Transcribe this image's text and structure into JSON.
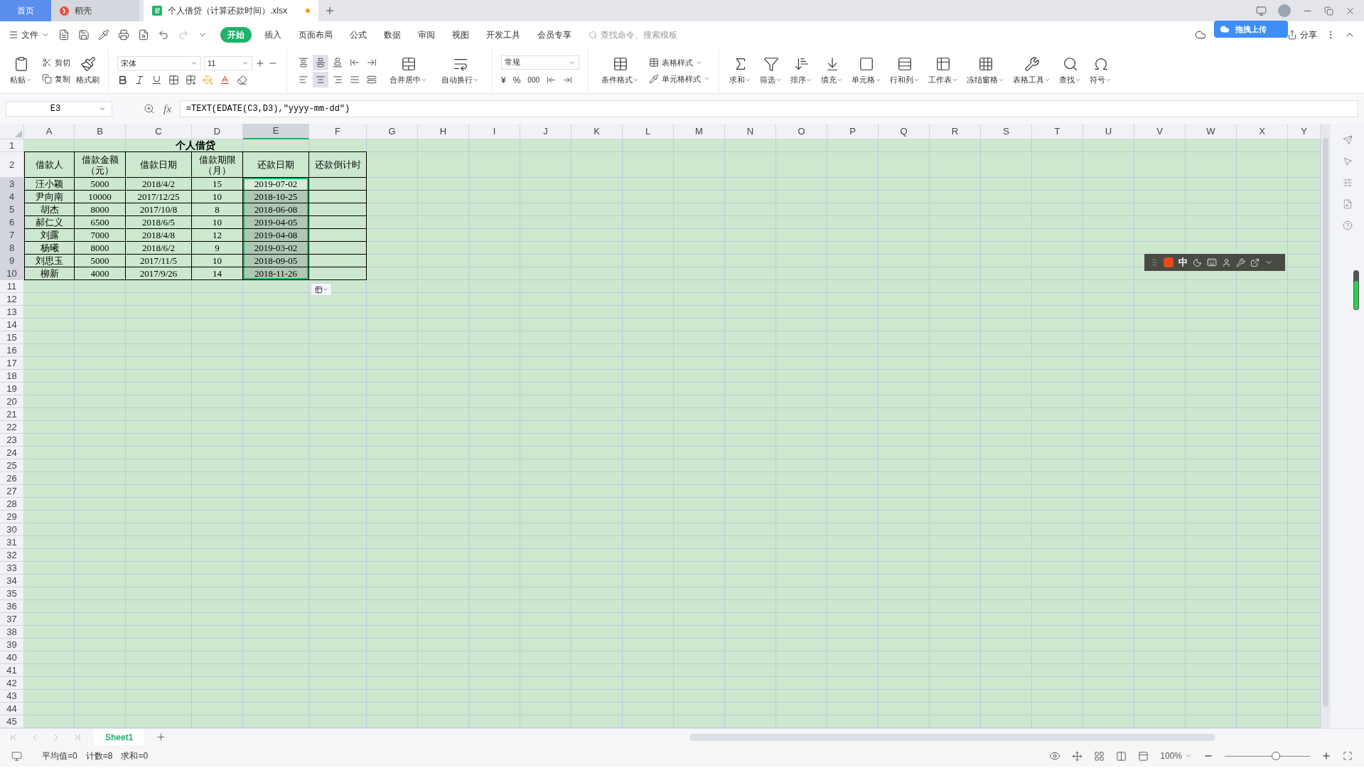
{
  "tabs": [
    {
      "label": "首页",
      "kind": "home",
      "selected": false,
      "modified": false
    },
    {
      "label": "稻壳",
      "kind": "docer",
      "selected": false,
      "modified": false
    },
    {
      "label": "个人借贷（计算还款时间）.xlsx",
      "kind": "file",
      "selected": true,
      "modified": true
    }
  ],
  "menu": {
    "file": "文件",
    "items": [
      {
        "label": "开始",
        "selected": true
      },
      {
        "label": "插入",
        "selected": false
      },
      {
        "label": "页面布局",
        "selected": false
      },
      {
        "label": "公式",
        "selected": false
      },
      {
        "label": "数据",
        "selected": false
      },
      {
        "label": "审阅",
        "selected": false
      },
      {
        "label": "视图",
        "selected": false
      },
      {
        "label": "开发工具",
        "selected": false
      },
      {
        "label": "会员专享",
        "selected": false
      }
    ],
    "search_placeholder": "查找命令、搜索模板",
    "share": "分享",
    "upload_popup": "拖拽上传"
  },
  "clipboard": {
    "paste": "粘贴",
    "cut": "剪切",
    "copy": "复制",
    "format_painter": "格式刷"
  },
  "font": {
    "name": "宋体",
    "size": "11"
  },
  "align_buttons": [
    {
      "kind": "top",
      "selected": false
    },
    {
      "kind": "middle",
      "selected": true
    },
    {
      "kind": "bottom",
      "selected": false
    },
    {
      "kind": "outdent",
      "selected": false
    },
    {
      "kind": "indent",
      "selected": false
    },
    {
      "kind": "left",
      "selected": false
    },
    {
      "kind": "center",
      "selected": true
    },
    {
      "kind": "right",
      "selected": false
    },
    {
      "kind": "justify",
      "selected": false
    },
    {
      "kind": "distributed",
      "selected": false
    }
  ],
  "merge": {
    "merge": "合并居中",
    "wrap": "自动换行"
  },
  "number": {
    "format": "常规",
    "currency": "¥",
    "percent": "%",
    "thousands": "000"
  },
  "styles": {
    "conditional": "条件格式",
    "table_style": "表格样式",
    "cell_style": "单元格样式"
  },
  "tools": [
    {
      "label": "求和",
      "kind": "sum"
    },
    {
      "label": "筛选",
      "kind": "filter"
    },
    {
      "label": "排序",
      "kind": "sort"
    },
    {
      "label": "填充",
      "kind": "fill"
    },
    {
      "label": "单元格",
      "kind": "cell"
    },
    {
      "label": "行和列",
      "kind": "rowcol"
    },
    {
      "label": "工作表",
      "kind": "sheet"
    },
    {
      "label": "冻结窗格",
      "kind": "freeze"
    },
    {
      "label": "表格工具",
      "kind": "tabletools"
    },
    {
      "label": "查找",
      "kind": "find"
    },
    {
      "label": "符号",
      "kind": "symbol"
    }
  ],
  "name_box": "E3",
  "function_label": "fx",
  "formula": "=TEXT(EDATE(C3,D3),\"yyyy-mm-dd\")",
  "columns": [
    {
      "label": "A",
      "selected": false
    },
    {
      "label": "B",
      "selected": false
    },
    {
      "label": "C",
      "selected": false
    },
    {
      "label": "D",
      "selected": false
    },
    {
      "label": "E",
      "selected": true
    },
    {
      "label": "F",
      "selected": false
    },
    {
      "label": "G",
      "selected": false
    },
    {
      "label": "H",
      "selected": false
    },
    {
      "label": "I",
      "selected": false
    },
    {
      "label": "J",
      "selected": false
    },
    {
      "label": "K",
      "selected": false
    },
    {
      "label": "L",
      "selected": false
    },
    {
      "label": "M",
      "selected": false
    },
    {
      "label": "N",
      "selected": false
    },
    {
      "label": "O",
      "selected": false
    },
    {
      "label": "P",
      "selected": false
    },
    {
      "label": "Q",
      "selected": false
    },
    {
      "label": "R",
      "selected": false
    },
    {
      "label": "S",
      "selected": false
    },
    {
      "label": "T",
      "selected": false
    },
    {
      "label": "U",
      "selected": false
    },
    {
      "label": "V",
      "selected": false
    },
    {
      "label": "W",
      "selected": false
    },
    {
      "label": "X",
      "selected": false
    },
    {
      "label": "Y",
      "selected": false
    }
  ],
  "row_numbers": [
    {
      "label": "1",
      "selected": false
    },
    {
      "label": "2",
      "selected": false
    },
    {
      "label": "3",
      "selected": true
    },
    {
      "label": "4",
      "selected": true
    },
    {
      "label": "5",
      "selected": true
    },
    {
      "label": "6",
      "selected": true
    },
    {
      "label": "7",
      "selected": true
    },
    {
      "label": "8",
      "selected": true
    },
    {
      "label": "9",
      "selected": true
    },
    {
      "label": "10",
      "selected": true
    },
    {
      "label": "11",
      "selected": false
    },
    {
      "label": "12",
      "selected": false
    },
    {
      "label": "13",
      "selected": false
    },
    {
      "label": "14",
      "selected": false
    },
    {
      "label": "15",
      "selected": false
    },
    {
      "label": "16",
      "selected": false
    },
    {
      "label": "17",
      "selected": false
    },
    {
      "label": "18",
      "selected": false
    },
    {
      "label": "19",
      "selected": false
    },
    {
      "label": "20",
      "selected": false
    },
    {
      "label": "21",
      "selected": false
    },
    {
      "label": "22",
      "selected": false
    },
    {
      "label": "23",
      "selected": false
    },
    {
      "label": "24",
      "selected": false
    },
    {
      "label": "25",
      "selected": false
    },
    {
      "label": "26",
      "selected": false
    },
    {
      "label": "27",
      "selected": false
    },
    {
      "label": "28",
      "selected": false
    },
    {
      "label": "29",
      "selected": false
    },
    {
      "label": "30",
      "selected": false
    },
    {
      "label": "31",
      "selected": false
    },
    {
      "label": "32",
      "selected": false
    },
    {
      "label": "33",
      "selected": false
    },
    {
      "label": "34",
      "selected": false
    },
    {
      "label": "35",
      "selected": false
    },
    {
      "label": "36",
      "selected": false
    },
    {
      "label": "37",
      "selected": false
    },
    {
      "label": "38",
      "selected": false
    },
    {
      "label": "39",
      "selected": false
    },
    {
      "label": "40",
      "selected": false
    },
    {
      "label": "41",
      "selected": false
    },
    {
      "label": "42",
      "selected": false
    },
    {
      "label": "43",
      "selected": false
    },
    {
      "label": "44",
      "selected": false
    },
    {
      "label": "45",
      "selected": false
    }
  ],
  "table": {
    "title": "个人借贷",
    "headers": [
      "借款人",
      "借款金额（元）",
      "借款日期",
      "借款期限（月）",
      "还款日期",
      "还款倒计时"
    ],
    "rows": [
      {
        "cells": [
          "汪小颖",
          "5000",
          "2018/4/2",
          "15",
          "2019-07-02"
        ],
        "active": true
      },
      {
        "cells": [
          "尹向南",
          "10000",
          "2017/12/25",
          "10",
          "2018-10-25"
        ],
        "active": false
      },
      {
        "cells": [
          "胡杰",
          "8000",
          "2017/10/8",
          "8",
          "2018-06-08"
        ],
        "active": false
      },
      {
        "cells": [
          "郝仁义",
          "6500",
          "2018/6/5",
          "10",
          "2019-04-05"
        ],
        "active": false
      },
      {
        "cells": [
          "刘露",
          "7000",
          "2018/4/8",
          "12",
          "2019-04-08"
        ],
        "active": false
      },
      {
        "cells": [
          "杨曦",
          "8000",
          "2018/6/2",
          "9",
          "2019-03-02"
        ],
        "active": false
      },
      {
        "cells": [
          "刘思玉",
          "5000",
          "2017/11/5",
          "10",
          "2018-09-05"
        ],
        "active": false
      },
      {
        "cells": [
          "柳新",
          "4000",
          "2017/9/26",
          "14",
          "2018-11-26"
        ],
        "active": false
      }
    ]
  },
  "ime_toolbar": {
    "mode": "中"
  },
  "sheets": [
    {
      "label": "Sheet1",
      "selected": true
    }
  ],
  "status": {
    "items": [
      "平均值=0",
      "计数=8",
      "求和=0"
    ],
    "zoom": "100%",
    "zoom_slider": {
      "level": 0.6
    }
  }
}
